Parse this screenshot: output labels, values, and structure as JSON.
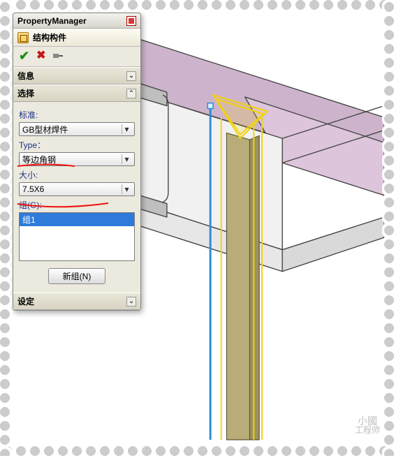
{
  "panel": {
    "title": "PropertyManager",
    "feature_name": "结构构件",
    "sections": {
      "info": {
        "title": "信息",
        "expanded": false
      },
      "select": {
        "title": "选择",
        "expanded": true
      },
      "settings": {
        "title": "设定",
        "expanded": false
      }
    },
    "fields": {
      "standard": {
        "label": "标准:",
        "value": "GB型材焊件"
      },
      "type": {
        "label": "Type：",
        "value": "等边角钢"
      },
      "size": {
        "label": "大小:",
        "value": "7.5X6"
      },
      "groups": {
        "label": "组(G):",
        "items": [
          "组1"
        ],
        "selected_index": 0
      }
    },
    "buttons": {
      "new_group": "新组(N)"
    }
  },
  "icons": {
    "ok": "✔",
    "cancel": "✖",
    "chev_down": "⌄",
    "chev_up": "⌃",
    "dropdown": "▾"
  },
  "watermark": {
    "line1": "小國",
    "line2": "工程师"
  }
}
